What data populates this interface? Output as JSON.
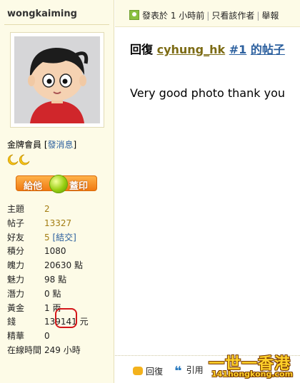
{
  "profile": {
    "username": "wongkaiming",
    "rank": "金牌會員",
    "send_message": "發消息",
    "moons": "☾☾",
    "give_button_left": "給他",
    "give_button_right": "蓋印"
  },
  "stats": [
    {
      "key": "主題",
      "value": "2",
      "link": true
    },
    {
      "key": "帖子",
      "value": "13327",
      "link": true
    },
    {
      "key": "好友",
      "value": "5",
      "link": true,
      "extra": "[結交]"
    },
    {
      "key": "積分",
      "value": "1080"
    },
    {
      "key": "魄力",
      "value": "20630 點"
    },
    {
      "key": "魅力",
      "value": "98 點"
    },
    {
      "key": "潛力",
      "value": "0 點"
    },
    {
      "key": "黃金",
      "value": "1 兩"
    },
    {
      "key": "錢",
      "value": "139141 元"
    },
    {
      "key": "精華",
      "value": "0"
    },
    {
      "key": "在線時間",
      "value": "249 小時"
    }
  ],
  "postbar": {
    "posted_at": "發表於 1 小時前",
    "only_author": "只看該作者",
    "report": "舉報"
  },
  "reply": {
    "prefix": "回復",
    "author": "cyhung_hk",
    "floor": "#1",
    "suffix": "的帖子",
    "text": "Very good photo thank you"
  },
  "actions": {
    "reply": "回復",
    "quote": "引用"
  },
  "watermark": {
    "line1": "一世一香港",
    "line2": "141hongkong.com"
  },
  "colors": {
    "sidebar_bg": "#fdfbe7",
    "link": "#2b5f9e",
    "highlight": "#d4161a"
  }
}
